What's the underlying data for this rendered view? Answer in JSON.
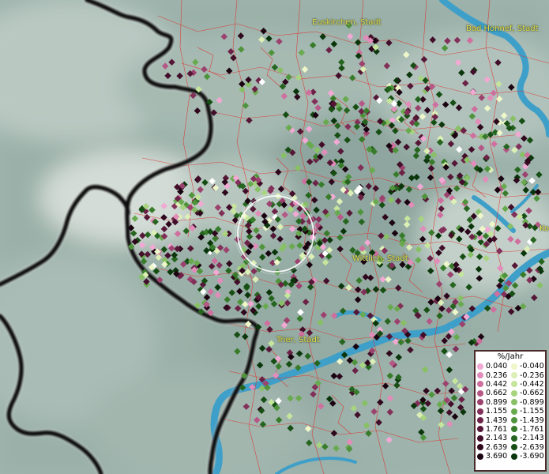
{
  "map": {
    "cities": [
      {
        "name": "Euskirchen, Stadt"
      },
      {
        "name": "Bad Honnef, Stadt"
      },
      {
        "name": "Wittlich, Stadt"
      },
      {
        "name": "Trier, Stadt"
      },
      {
        "name": "Ko"
      }
    ],
    "colors": {
      "water": "#3e9fc9",
      "boundary_lines": "#e0302c",
      "border": "#111111",
      "label_text": "#e8e24a"
    }
  },
  "legend": {
    "title": "%/Jahr",
    "rows": [
      {
        "pos_value": "0.040",
        "pos_color": "#f1a9d3",
        "neg_value": "-0.040",
        "neg_color": "#eef7c9"
      },
      {
        "pos_value": "0.236",
        "pos_color": "#e28cba",
        "neg_value": "-0.236",
        "neg_color": "#dcefb6"
      },
      {
        "pos_value": "0.442",
        "pos_color": "#cf6f9e",
        "neg_value": "-0.442",
        "neg_color": "#c6e59c"
      },
      {
        "pos_value": "0.662",
        "pos_color": "#b65886",
        "neg_value": "-0.662",
        "neg_color": "#a8d47f"
      },
      {
        "pos_value": "0.899",
        "pos_color": "#9c426e",
        "neg_value": "-0.899",
        "neg_color": "#88c066"
      },
      {
        "pos_value": "1.155",
        "pos_color": "#823059",
        "neg_value": "-1.155",
        "neg_color": "#69aa4f"
      },
      {
        "pos_value": "1.439",
        "pos_color": "#6c2247",
        "neg_value": "-1.439",
        "neg_color": "#4f943c"
      },
      {
        "pos_value": "1.761",
        "pos_color": "#561737",
        "neg_value": "-1.761",
        "neg_color": "#387c2b"
      },
      {
        "pos_value": "2.143",
        "pos_color": "#420e29",
        "neg_value": "-2.143",
        "neg_color": "#26651f"
      },
      {
        "pos_value": "2.639",
        "pos_color": "#2e071c",
        "neg_value": "-2.639",
        "neg_color": "#174e14"
      },
      {
        "pos_value": "3.690",
        "pos_color": "#1a0310",
        "neg_value": "-3.690",
        "neg_color": "#0b360c"
      }
    ]
  }
}
